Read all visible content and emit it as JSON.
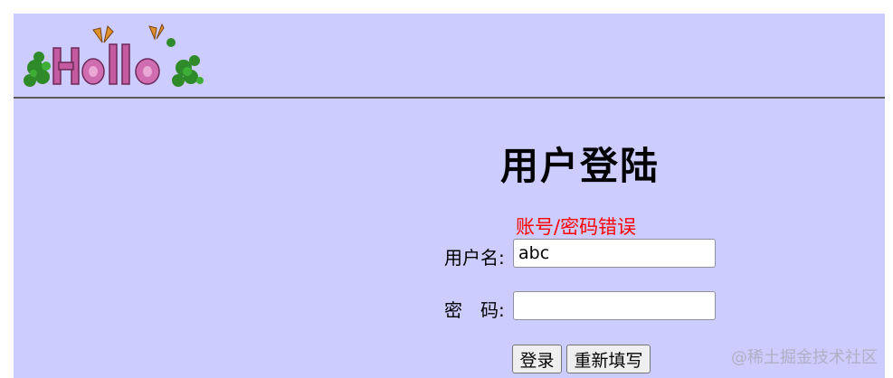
{
  "header": {
    "logo_text": "Hello"
  },
  "login": {
    "title": "用户登陆",
    "error_message": "账号/密码错误",
    "username_label": "用户名:",
    "username_value": "abc",
    "password_label": "密　码:",
    "password_value": "",
    "login_button": "登录",
    "reset_button": "重新填写"
  },
  "watermark": "@稀土掘金技术社区",
  "colors": {
    "page_background": "#ccccff",
    "error_text": "#ff0000",
    "divider": "#5a5a5a"
  }
}
